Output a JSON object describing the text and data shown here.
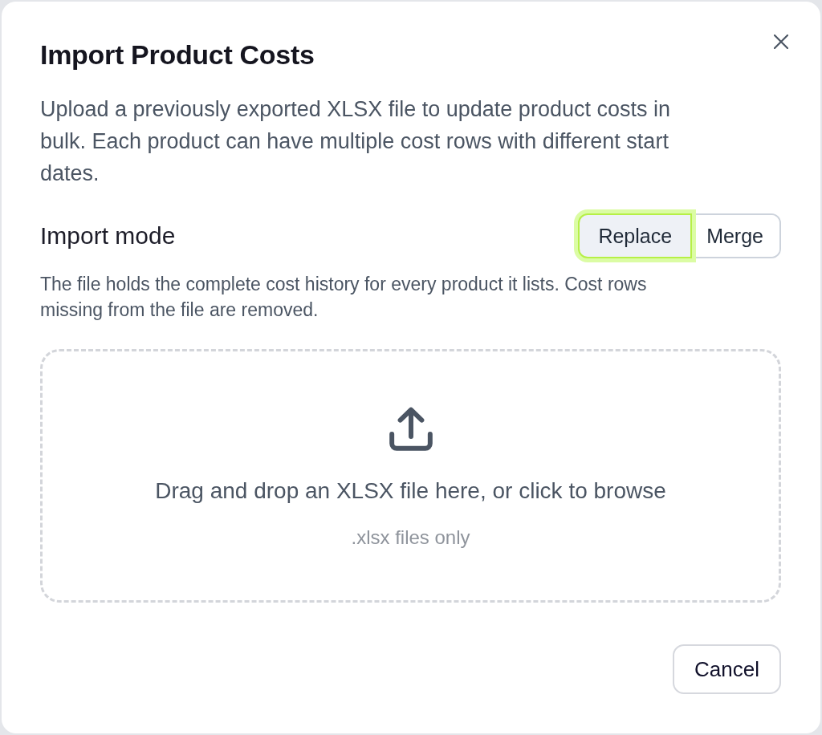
{
  "dialog": {
    "title": "Import Product Costs",
    "description": "Upload a previously exported XLSX file to update product costs in bulk. Each product can have multiple cost rows with different start dates.",
    "import_mode": {
      "label": "Import mode",
      "options": [
        {
          "label": "Replace",
          "selected": true
        },
        {
          "label": "Merge",
          "selected": false
        }
      ],
      "help": "The file holds the complete cost history for every product it lists. Cost rows missing from the file are removed."
    },
    "dropzone": {
      "prompt": "Drag and drop an XLSX file here, or click to browse",
      "hint": ".xlsx files only"
    },
    "buttons": [
      {
        "label": "Cancel"
      }
    ]
  }
}
